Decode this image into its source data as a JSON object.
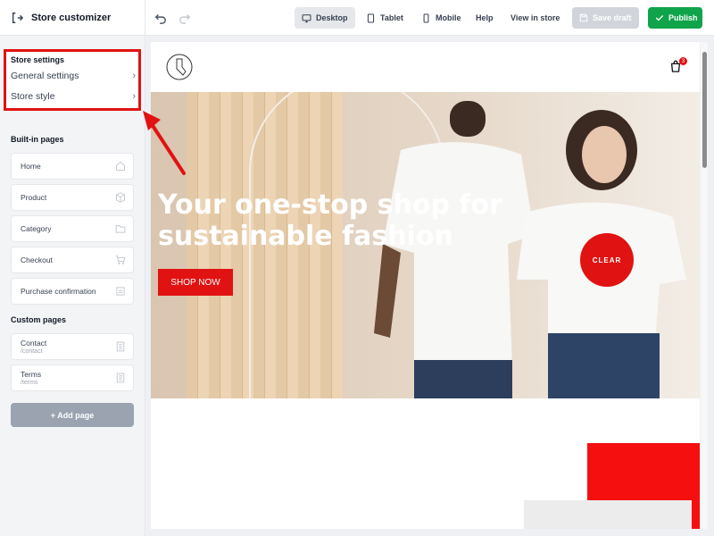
{
  "app": {
    "title": "Store customizer"
  },
  "toolbar": {
    "desktop": "Desktop",
    "tablet": "Tablet",
    "mobile": "Mobile",
    "help": "Help",
    "view_in_store": "View in store",
    "save_draft": "Save draft",
    "publish": "Publish"
  },
  "sidebar": {
    "store_settings": {
      "heading": "Store settings",
      "items": [
        {
          "label": "General settings",
          "icon": "chevron-right-icon"
        },
        {
          "label": "Store style",
          "icon": "chevron-right-icon"
        }
      ]
    },
    "built_in": {
      "heading": "Built-in pages",
      "items": [
        {
          "label": "Home",
          "icon": "home-icon"
        },
        {
          "label": "Product",
          "icon": "box-icon"
        },
        {
          "label": "Category",
          "icon": "folder-icon"
        },
        {
          "label": "Checkout",
          "icon": "cart-icon"
        },
        {
          "label": "Purchase confirmation",
          "icon": "receipt-icon"
        }
      ]
    },
    "custom": {
      "heading": "Custom pages",
      "items": [
        {
          "label": "Contact",
          "path": "/contact",
          "icon": "page-icon"
        },
        {
          "label": "Terms",
          "path": "/terms",
          "icon": "page-icon"
        }
      ]
    },
    "add_page": "+ Add page"
  },
  "preview": {
    "cart_count": "3",
    "hero_title": "Your one-stop shop for sustainable fashion",
    "cta": "SHOP NOW",
    "badge": "CLEAR"
  },
  "colors": {
    "accent_red": "#e11212",
    "publish_green": "#10a44a",
    "save_disabled": "#d1d5db"
  }
}
